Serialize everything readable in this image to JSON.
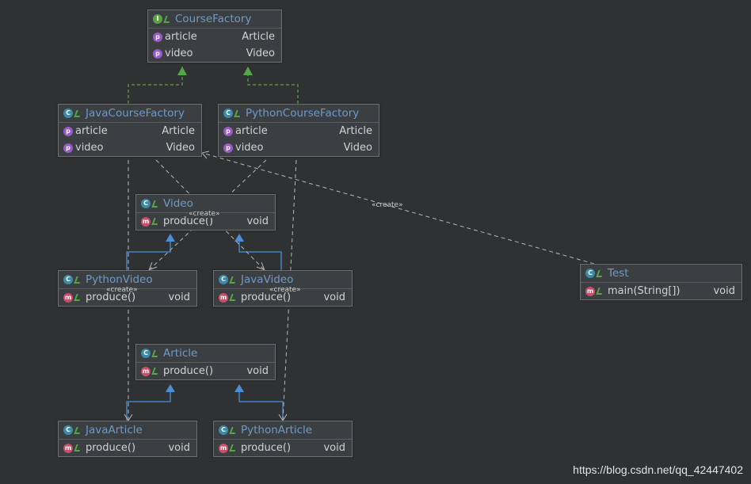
{
  "classes": {
    "course_factory": {
      "name": "CourseFactory",
      "kind": "interface",
      "members": [
        {
          "name": "article",
          "type": "Article"
        },
        {
          "name": "video",
          "type": "Video"
        }
      ]
    },
    "java_course_factory": {
      "name": "JavaCourseFactory",
      "kind": "class",
      "members": [
        {
          "name": "article",
          "type": "Article"
        },
        {
          "name": "video",
          "type": "Video"
        }
      ]
    },
    "python_course_factory": {
      "name": "PythonCourseFactory",
      "kind": "class",
      "members": [
        {
          "name": "article",
          "type": "Article"
        },
        {
          "name": "video",
          "type": "Video"
        }
      ]
    },
    "video": {
      "name": "Video",
      "kind": "abstract-class",
      "members": [
        {
          "name": "produce()",
          "type": "void"
        }
      ]
    },
    "python_video": {
      "name": "PythonVideo",
      "kind": "class",
      "members": [
        {
          "name": "produce()",
          "type": "void"
        }
      ]
    },
    "java_video": {
      "name": "JavaVideo",
      "kind": "class",
      "members": [
        {
          "name": "produce()",
          "type": "void"
        }
      ]
    },
    "article": {
      "name": "Article",
      "kind": "abstract-class",
      "members": [
        {
          "name": "produce()",
          "type": "void"
        }
      ]
    },
    "java_article": {
      "name": "JavaArticle",
      "kind": "class",
      "members": [
        {
          "name": "produce()",
          "type": "void"
        }
      ]
    },
    "python_article": {
      "name": "PythonArticle",
      "kind": "class",
      "members": [
        {
          "name": "produce()",
          "type": "void"
        }
      ]
    },
    "test": {
      "name": "Test",
      "kind": "class",
      "members": [
        {
          "name": "main(String[])",
          "type": "void"
        }
      ]
    }
  },
  "stereotypes": {
    "create": "«create»"
  },
  "relations": [
    {
      "from": "JavaCourseFactory",
      "to": "CourseFactory",
      "kind": "realization"
    },
    {
      "from": "PythonCourseFactory",
      "to": "CourseFactory",
      "kind": "realization"
    },
    {
      "from": "PythonVideo",
      "to": "Video",
      "kind": "generalization"
    },
    {
      "from": "JavaVideo",
      "to": "Video",
      "kind": "generalization"
    },
    {
      "from": "JavaArticle",
      "to": "Article",
      "kind": "generalization"
    },
    {
      "from": "PythonArticle",
      "to": "Article",
      "kind": "generalization"
    },
    {
      "from": "JavaCourseFactory",
      "to": "JavaVideo",
      "kind": "create"
    },
    {
      "from": "PythonCourseFactory",
      "to": "PythonVideo",
      "kind": "create"
    },
    {
      "from": "JavaCourseFactory",
      "to": "JavaArticle",
      "kind": "create"
    },
    {
      "from": "PythonCourseFactory",
      "to": "PythonArticle",
      "kind": "create"
    },
    {
      "from": "Test",
      "to": "JavaCourseFactory",
      "kind": "create"
    }
  ],
  "colors": {
    "background": "#2f3133",
    "box": "#3c3f41",
    "realization": "#57a64a",
    "generalization": "#4a8fd8",
    "dependency": "#b8b8b8"
  },
  "watermark": "https://blog.csdn.net/qq_42447402"
}
